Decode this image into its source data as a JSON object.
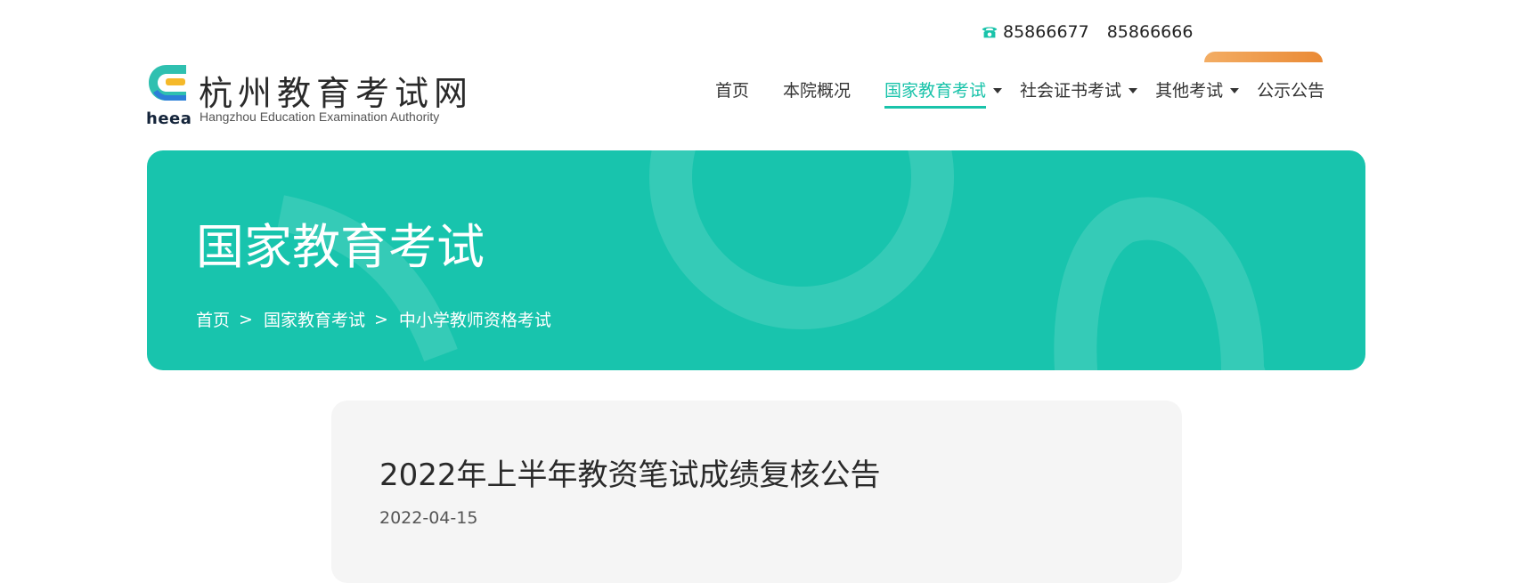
{
  "contact": {
    "phone_1": "85866677",
    "phone_2": "85866666"
  },
  "logo": {
    "abbr": "heea",
    "name_cn": "杭州教育考试网",
    "name_en": "Hangzhou Education Examination Authority"
  },
  "nav": {
    "items": [
      {
        "label": "首页"
      },
      {
        "label": "本院概况"
      },
      {
        "label": "国家教育考试"
      },
      {
        "label": "社会证书考试"
      },
      {
        "label": "其他考试"
      },
      {
        "label": "公示公告"
      }
    ],
    "active_index": 2
  },
  "banner": {
    "title": "国家教育考试",
    "breadcrumb": [
      "首页",
      "国家教育考试",
      "中小学教师资格考试"
    ],
    "separator": ">"
  },
  "article": {
    "title": "2022年上半年教资笔试成绩复核公告",
    "date": "2022-04-15"
  },
  "colors": {
    "accent": "#19c3aa",
    "banner": "#18c4ad",
    "orange": "#ea8a35"
  },
  "icons": [
    "phone-icon",
    "caret-down-icon",
    "logo-mark"
  ]
}
